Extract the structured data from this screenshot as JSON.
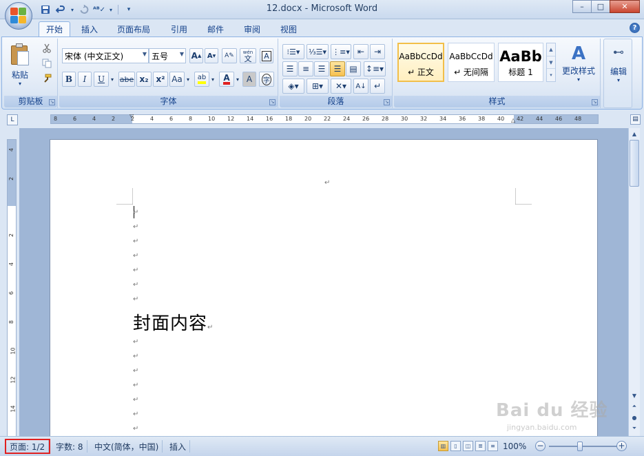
{
  "window": {
    "title": "12.docx - Microsoft Word",
    "controls": {
      "minimize": "–",
      "maximize": "□",
      "close": "✕"
    }
  },
  "quick_access": {
    "customize": "▾"
  },
  "tabs": [
    {
      "label": "开始",
      "active": true
    },
    {
      "label": "插入"
    },
    {
      "label": "页面布局"
    },
    {
      "label": "引用"
    },
    {
      "label": "邮件"
    },
    {
      "label": "审阅"
    },
    {
      "label": "视图"
    }
  ],
  "ribbon": {
    "clipboard": {
      "label": "剪贴板",
      "paste": "粘贴"
    },
    "font": {
      "label": "字体",
      "font_name": "宋体 (中文正文)",
      "font_size": "五号",
      "grow": "A",
      "shrink": "A",
      "bold": "B",
      "italic": "I",
      "underline": "U",
      "strike": "abe",
      "subscript": "x₂",
      "superscript": "x²",
      "change_case": "Aa",
      "highlight": "ab",
      "font_color": "A",
      "char_shading": "A",
      "enclose": "字",
      "phonetic": "wén",
      "phonetic_char": "文",
      "char_border": "A"
    },
    "paragraph": {
      "label": "段落"
    },
    "styles": {
      "label": "样式",
      "gallery": [
        {
          "sample": "AaBbCcDd",
          "name": "↵ 正文",
          "selected": true
        },
        {
          "sample": "AaBbCcDd",
          "name": "↵ 无间隔"
        },
        {
          "sample": "AaBb",
          "name": "标题 1"
        }
      ],
      "change_styles": "更改样式"
    },
    "editing": {
      "label": "编辑"
    }
  },
  "ruler": {
    "horizontal_labels": [
      "8",
      "6",
      "4",
      "2",
      "2",
      "4",
      "6",
      "8",
      "10",
      "12",
      "14",
      "16",
      "18",
      "20",
      "22",
      "24",
      "26",
      "28",
      "30",
      "32",
      "34",
      "36",
      "38",
      "40",
      "42",
      "44",
      "46",
      "48"
    ],
    "vertical_labels": [
      "4",
      "2",
      "2",
      "4",
      "6",
      "8",
      "10",
      "12",
      "14"
    ]
  },
  "document": {
    "paragraph_mark": "↵",
    "cover_text": "封面内容"
  },
  "status": {
    "page": "页面: 1/2",
    "words": "字数: 8",
    "language": "中文(简体，中国)",
    "mode": "插入",
    "zoom": "100%"
  },
  "watermark": {
    "text": "Bai du 经验",
    "sub": "jingyan.baidu.com"
  },
  "colors": {
    "accent": "#15428b",
    "highlight_red": "#e02020",
    "ribbon_border": "#8db2e3"
  }
}
